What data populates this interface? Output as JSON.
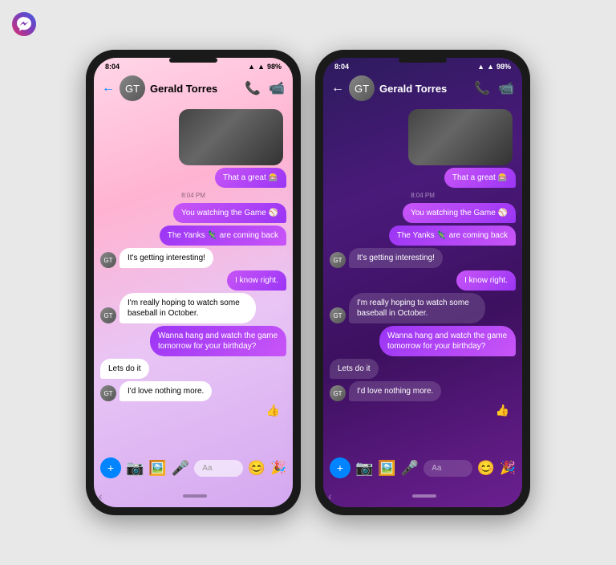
{
  "app": {
    "title": "Messenger"
  },
  "phone_light": {
    "status": {
      "time": "8:04",
      "battery": "98%"
    },
    "header": {
      "back_label": "←",
      "contact_name": "Gerald Torres",
      "phone_icon": "📞",
      "video_icon": "📹"
    },
    "messages": [
      {
        "id": "img1",
        "type": "image",
        "side": "outgoing"
      },
      {
        "id": "m1",
        "type": "bubble",
        "side": "outgoing",
        "text": "That a great 🎰",
        "style": "outgoing-purple"
      },
      {
        "id": "ts1",
        "type": "timestamp",
        "text": "8:04 PM"
      },
      {
        "id": "m2",
        "type": "bubble",
        "side": "outgoing",
        "text": "You watching the Game ⚾",
        "style": "outgoing-purple"
      },
      {
        "id": "m3",
        "type": "bubble",
        "side": "outgoing",
        "text": "The Yanks 🦎 are coming back",
        "style": "outgoing-gradient"
      },
      {
        "id": "m4",
        "type": "bubble",
        "side": "incoming",
        "text": "It's getting interesting!",
        "style": "incoming-white",
        "has_avatar": true
      },
      {
        "id": "m5",
        "type": "bubble",
        "side": "outgoing",
        "text": "I know right.",
        "style": "outgoing-purple"
      },
      {
        "id": "m6",
        "type": "bubble",
        "side": "incoming",
        "text": "I'm really hoping to watch some baseball in October.",
        "style": "incoming-white",
        "has_avatar": true
      },
      {
        "id": "m7",
        "type": "bubble",
        "side": "outgoing",
        "text": "Wanna hang and watch the game tomorrow for your birthday?",
        "style": "outgoing-gradient"
      },
      {
        "id": "m8",
        "type": "bubble",
        "side": "incoming",
        "text": "Lets do it",
        "style": "incoming-white"
      },
      {
        "id": "m9",
        "type": "bubble",
        "side": "incoming",
        "text": "I'd love nothing more.",
        "style": "incoming-white",
        "has_avatar": true
      },
      {
        "id": "emoji1",
        "type": "emoji",
        "side": "outgoing",
        "text": "👍"
      }
    ],
    "toolbar": {
      "plus_label": "+",
      "camera_label": "📷",
      "gallery_label": "🖼️",
      "mic_label": "🎤",
      "input_placeholder": "Aa",
      "emoji_label": "😊",
      "confetti_label": "🎉"
    }
  },
  "phone_dark": {
    "status": {
      "time": "8:04",
      "battery": "98%"
    },
    "header": {
      "back_label": "←",
      "contact_name": "Gerald Torres",
      "phone_icon": "📞",
      "video_icon": "📹"
    },
    "messages": [
      {
        "id": "img1",
        "type": "image",
        "side": "outgoing"
      },
      {
        "id": "m1",
        "type": "bubble",
        "side": "outgoing",
        "text": "That a great 🎰",
        "style": "outgoing-purple"
      },
      {
        "id": "ts1",
        "type": "timestamp",
        "text": "8:04 PM"
      },
      {
        "id": "m2",
        "type": "bubble",
        "side": "outgoing",
        "text": "You watching the Game ⚾",
        "style": "outgoing-purple"
      },
      {
        "id": "m3",
        "type": "bubble",
        "side": "outgoing",
        "text": "The Yanks 🦎 are coming back",
        "style": "outgoing-gradient"
      },
      {
        "id": "m4",
        "type": "bubble",
        "side": "incoming",
        "text": "It's getting interesting!",
        "style": "incoming-white",
        "has_avatar": true
      },
      {
        "id": "m5",
        "type": "bubble",
        "side": "outgoing",
        "text": "I know right.",
        "style": "outgoing-purple"
      },
      {
        "id": "m6",
        "type": "bubble",
        "side": "incoming",
        "text": "I'm really hoping to watch some baseball in October.",
        "style": "incoming-white",
        "has_avatar": true
      },
      {
        "id": "m7",
        "type": "bubble",
        "side": "outgoing",
        "text": "Wanna hang and watch the game tomorrow for your birthday?",
        "style": "outgoing-gradient"
      },
      {
        "id": "m8",
        "type": "bubble",
        "side": "incoming",
        "text": "Lets do it",
        "style": "incoming-white"
      },
      {
        "id": "m9",
        "type": "bubble",
        "side": "incoming",
        "text": "I'd love nothing more.",
        "style": "incoming-white",
        "has_avatar": true
      },
      {
        "id": "emoji1",
        "type": "emoji",
        "side": "outgoing",
        "text": "👍"
      }
    ],
    "toolbar": {
      "plus_label": "+",
      "camera_label": "📷",
      "gallery_label": "🖼️",
      "mic_label": "🎤",
      "input_placeholder": "Aa",
      "emoji_label": "😊",
      "confetti_label": "🎉"
    }
  }
}
